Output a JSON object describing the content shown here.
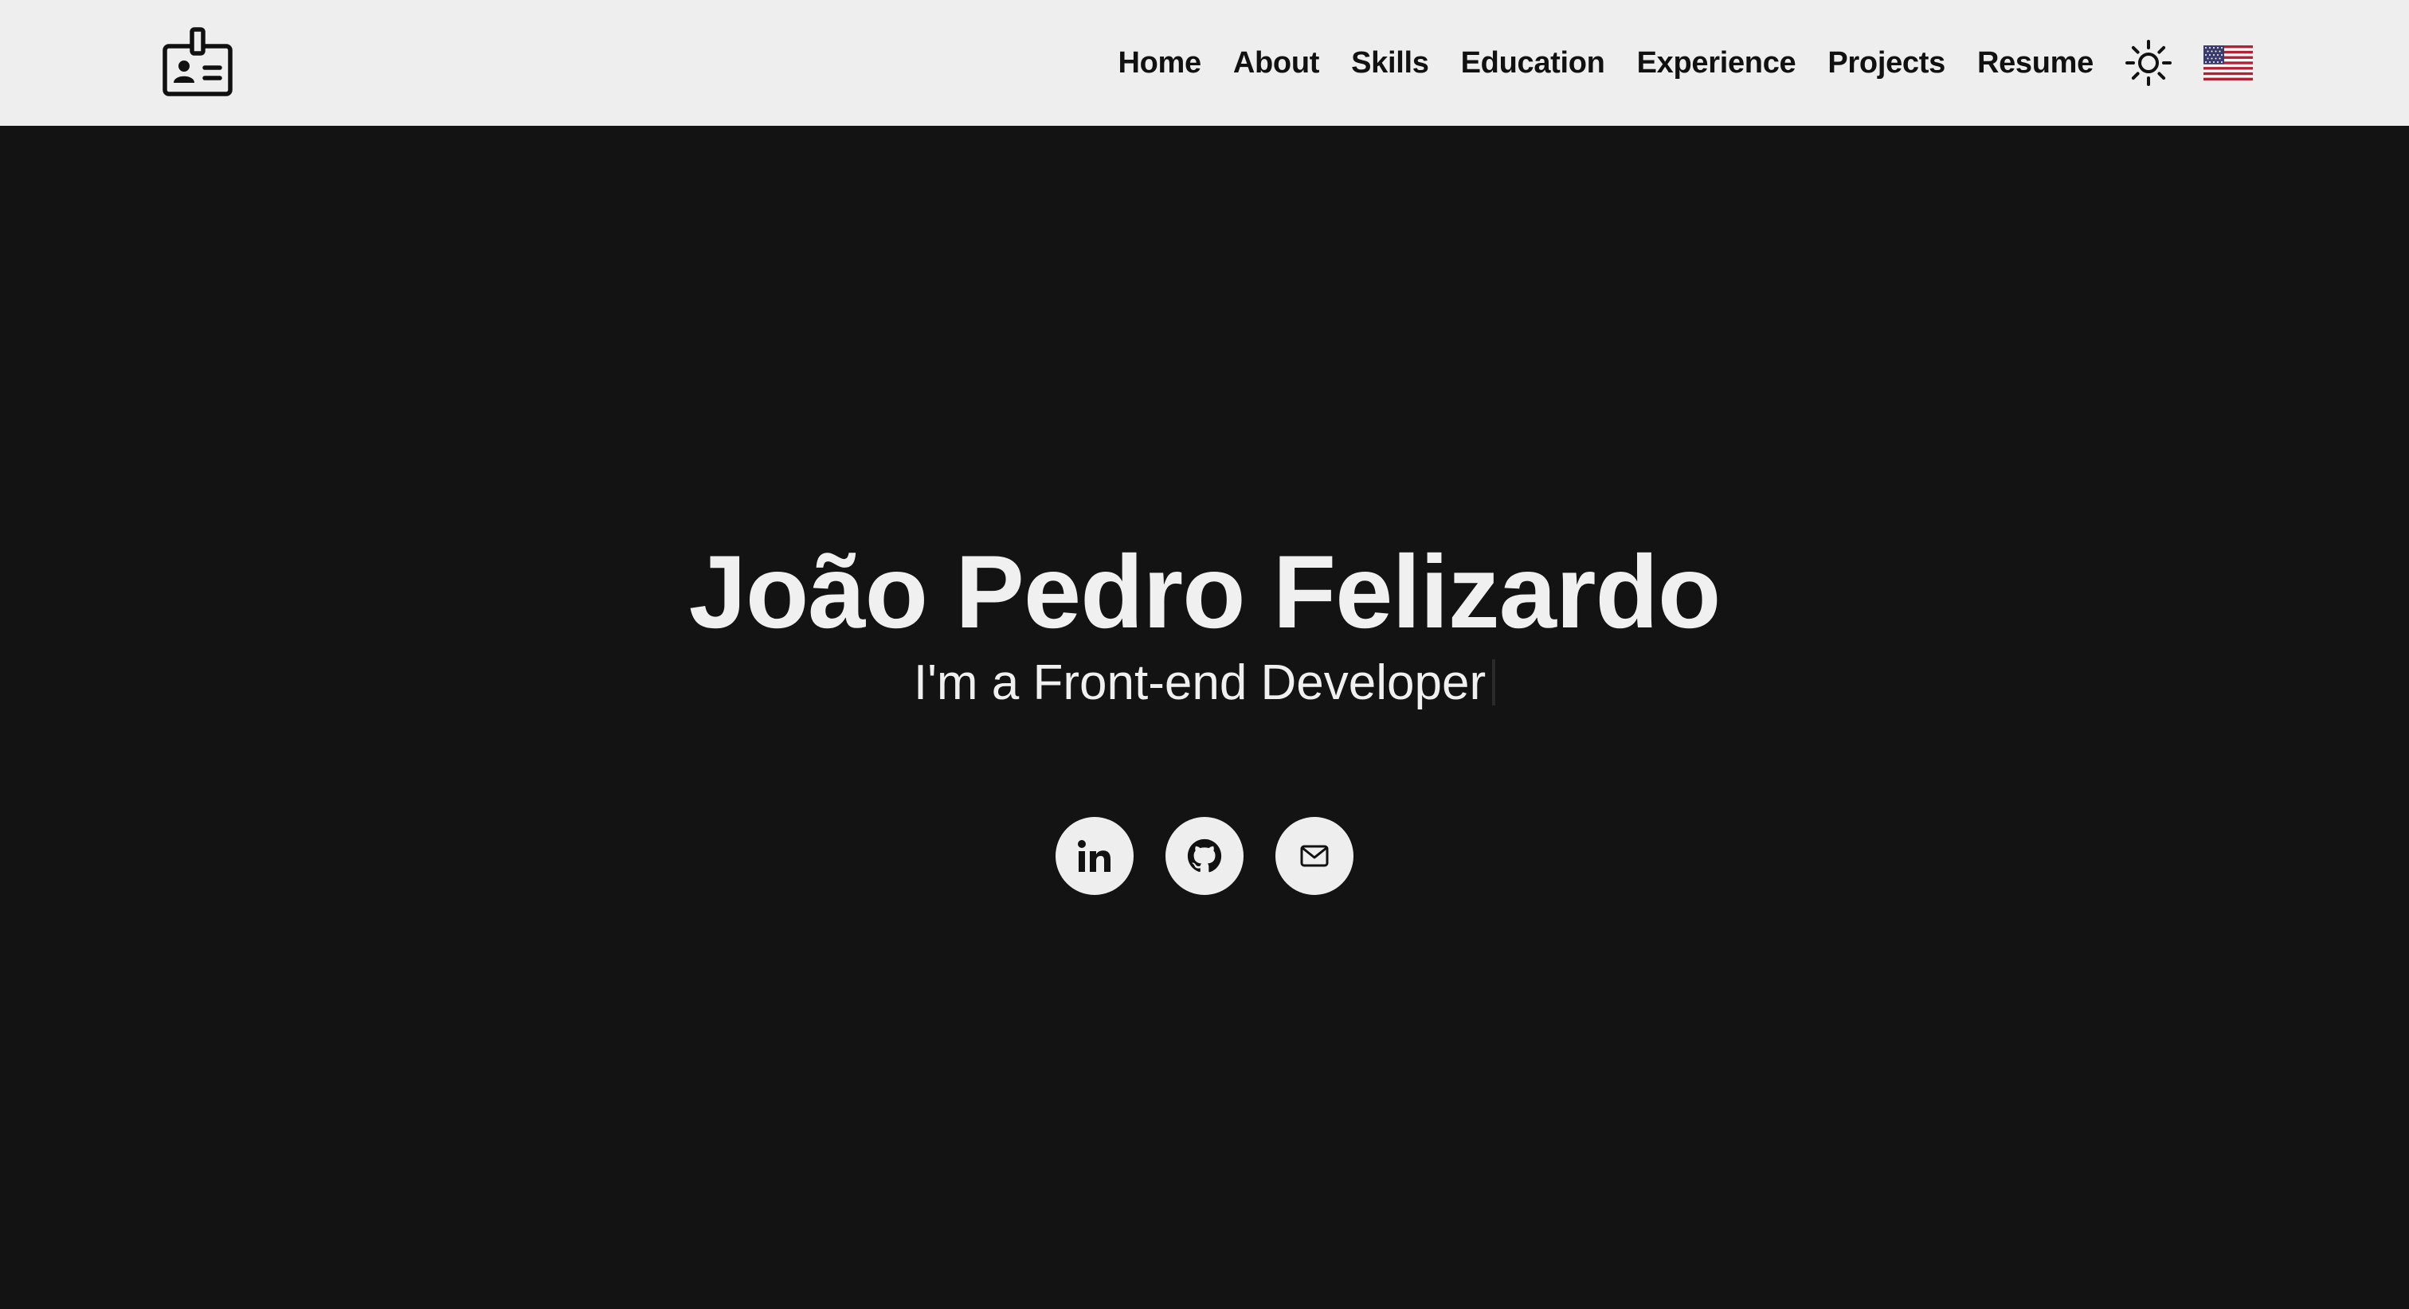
{
  "nav": {
    "logo_icon": "id-badge-icon",
    "links": [
      {
        "label": "Home"
      },
      {
        "label": "About"
      },
      {
        "label": "Skills"
      },
      {
        "label": "Education"
      },
      {
        "label": "Experience"
      },
      {
        "label": "Projects"
      },
      {
        "label": "Resume"
      }
    ],
    "theme_icon": "sun-icon",
    "language_icon": "us-flag-icon"
  },
  "hero": {
    "name": "João Pedro Felizardo",
    "subtitle": "I'm a Front-end Developer"
  },
  "socials": [
    {
      "icon": "linkedin-icon"
    },
    {
      "icon": "github-icon"
    },
    {
      "icon": "mail-icon"
    }
  ],
  "colors": {
    "background": "#131313",
    "navbar": "#eeeeee",
    "text_light": "#f0f0f0",
    "text_dark": "#111111"
  }
}
